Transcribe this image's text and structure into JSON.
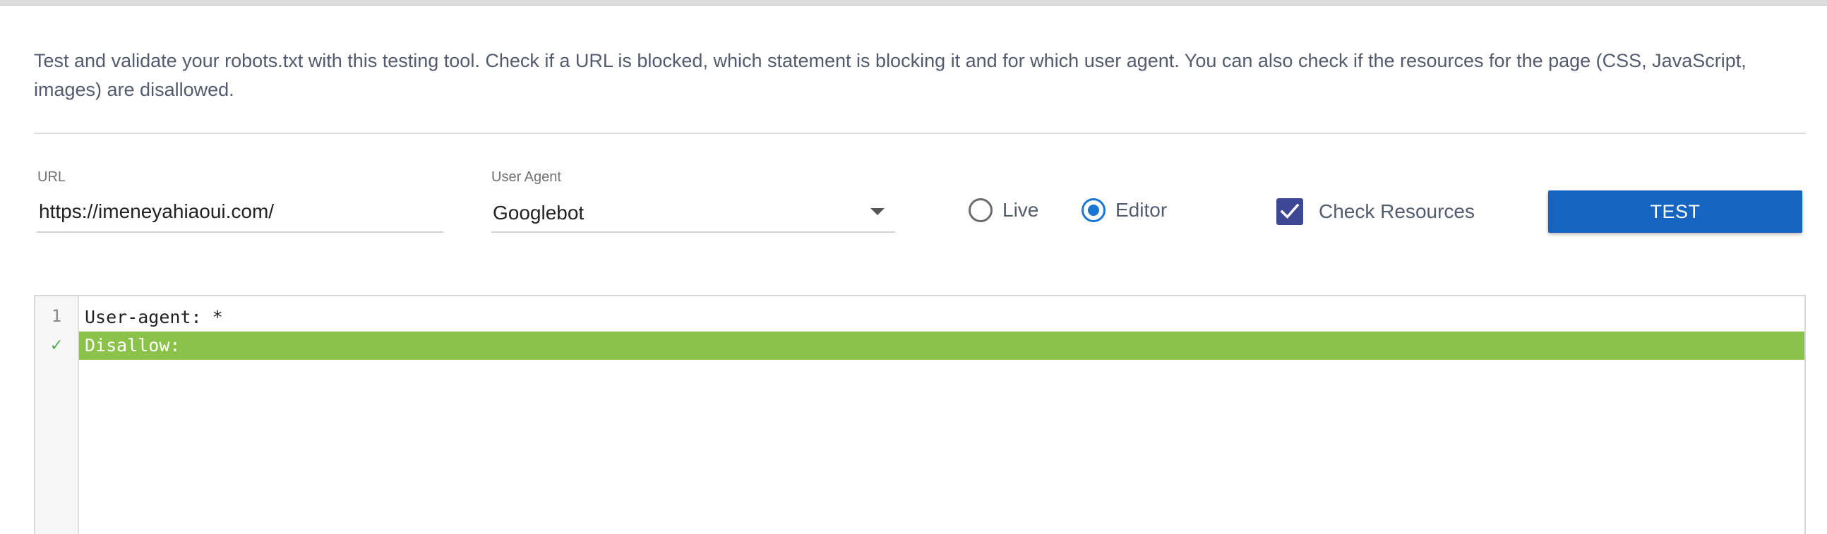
{
  "description": "Test and validate your robots.txt with this testing tool. Check if a URL is blocked, which statement is blocking it and for which user agent. You can also check if the resources for the page (CSS, JavaScript, images) are disallowed.",
  "url_field": {
    "label": "URL",
    "value": "https://imeneyahiaoui.com/"
  },
  "user_agent": {
    "label": "User Agent",
    "selected": "Googlebot"
  },
  "mode": {
    "options": [
      {
        "label": "Live",
        "checked": false
      },
      {
        "label": "Editor",
        "checked": true
      }
    ]
  },
  "check_resources": {
    "label": "Check Resources",
    "checked": true
  },
  "test_button": {
    "label": "TEST"
  },
  "editor": {
    "lines": [
      {
        "gutter": "1",
        "text": "User-agent: *",
        "status": "normal"
      },
      {
        "gutter": "✓",
        "text": "Disallow:",
        "status": "allowed"
      }
    ]
  },
  "colors": {
    "accent": "#1565c0",
    "radio_selected": "#1976d2",
    "checkbox": "#3c4894",
    "allowed_highlight": "#8bc34a",
    "check_mark": "#4caf50"
  },
  "icons": {
    "dropdown": "chevron-down-icon",
    "checkbox": "checkmark-icon",
    "gutter_status": "check-icon"
  }
}
